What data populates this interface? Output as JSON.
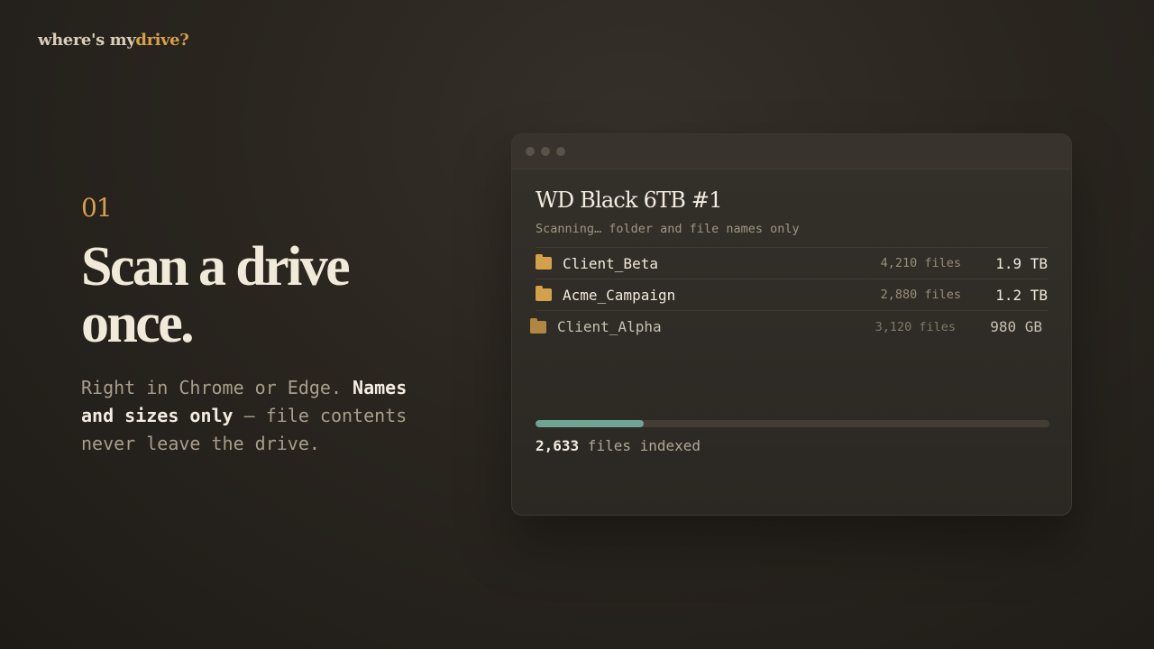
{
  "brand": {
    "part1": "where's my",
    "part2": "drive?"
  },
  "hero": {
    "step": "01",
    "title_line1": "Scan a drive",
    "title_line2": "once.",
    "body_start": "Right in Chrome or Edge. ",
    "body_bold": "Names and sizes only",
    "body_end": " — file contents never leave the drive."
  },
  "window": {
    "drive_name": "WD Black 6TB #1",
    "status": "Scanning… folder and file names only",
    "rows": [
      {
        "name": "Client_Beta",
        "count": "4,210 files",
        "size": "1.9 TB",
        "icon": "folder-icon"
      },
      {
        "name": "Acme_Campaign",
        "count": "2,880 files",
        "size": "1.2 TB",
        "icon": "folder-icon"
      },
      {
        "name": "Client_Alpha",
        "count": "3,120 files",
        "size": "980 GB",
        "icon": "folder-icon"
      }
    ],
    "progress": {
      "fraction": 0.21,
      "count": "2,633",
      "label": " files indexed"
    }
  },
  "colors": {
    "accent": "#d4a04a",
    "progress": "#6fa394",
    "background": "#2a251f"
  }
}
